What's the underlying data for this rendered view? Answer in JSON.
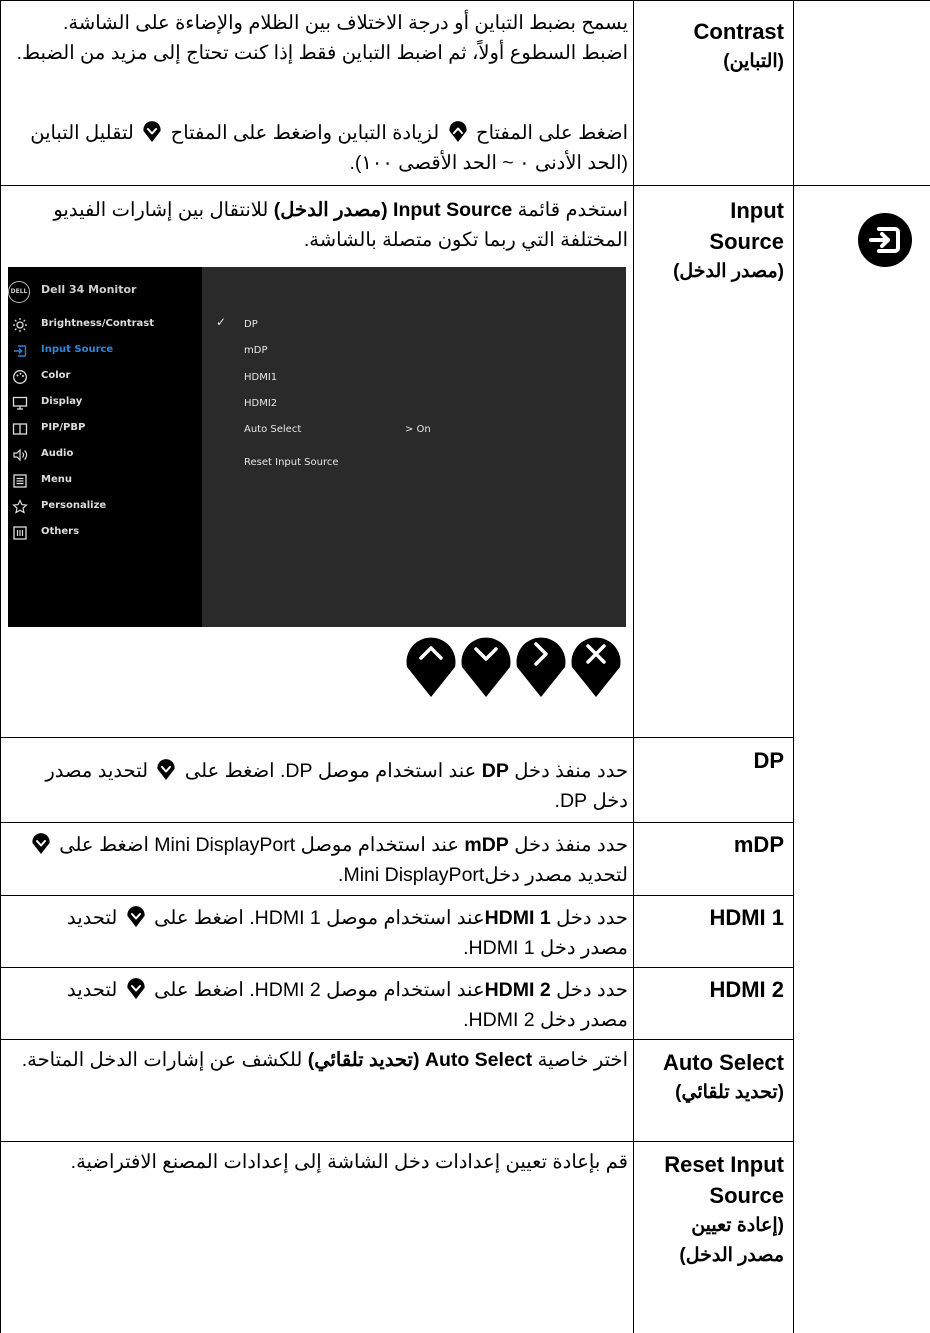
{
  "rows": {
    "contrast": {
      "title": "Contrast",
      "title_ar": "(التباين)",
      "desc1": "يسمح بضبط التباين أو درجة الاختلاف بين الظلام والإضاءة على الشاشة. اضبط السطوع أولاً، ثم اضبط التباين فقط إذا كنت تحتاج إلى مزيد من الضبط.",
      "desc2_a": "اضغط على المفتاح",
      "desc2_b": "لزيادة التباين واضغط على المفتاح",
      "desc2_c": "لتقليل التباين (الحد الأدنى ٠ ~ الحد الأقصى ١٠٠)."
    },
    "input_source": {
      "title": "Input Source",
      "title_ar": "(مصدر الدخل)",
      "icon": "input-source-icon",
      "desc_a": "استخدم قائمة",
      "desc_bold_en": "Input Source",
      "desc_bold_ar": "(مصدر الدخل)",
      "desc_b": "للانتقال بين إشارات الفيديو المختلفة التي ربما تكون متصلة بالشاشة."
    },
    "dp": {
      "title": "DP",
      "a": "حدد منفذ دخل",
      "bold": "DP",
      "b": "عند استخدام موصل DP. اضغط على",
      "c": "لتحديد مصدر دخل DP."
    },
    "mdp": {
      "title": "mDP",
      "a": "حدد منفذ دخل",
      "bold": "mDP",
      "b": "عند استخدام موصل Mini DisplayPort اضغط على",
      "c": "لتحديد مصدر دخلMini DisplayPort."
    },
    "hdmi1": {
      "title": "HDMI 1",
      "a": "حدد دخل",
      "bold": "HDMI 1",
      "b": "عند استخدام موصل HDMI 1. اضغط على",
      "c": "لتحديد مصدر دخل HDMI 1."
    },
    "hdmi2": {
      "title": "HDMI 2",
      "a": "حدد دخل",
      "bold": "HDMI 2",
      "b": "عند استخدام موصل HDMI 2. اضغط على",
      "c": "لتحديد مصدر دخل HDMI 2."
    },
    "auto_select": {
      "title": "Auto Select",
      "title_ar": "(تحديد تلقائي)",
      "a": "اختر خاصية",
      "bold_en": "Auto Select",
      "bold_ar": "(تحديد تلقائي)",
      "b": "للكشف عن إشارات الدخل المتاحة."
    },
    "reset": {
      "title": "Reset Input Source",
      "title_ar": "(إعادة تعيين مصدر الدخل)",
      "desc": "قم بإعادة تعيين إعدادات دخل الشاشة إلى إعدادات المصنع الافتراضية."
    }
  },
  "osd": {
    "logo": "DELL",
    "title": "Dell 34 Monitor",
    "menu": [
      {
        "label": "Brightness/Contrast",
        "icon": "brightness-icon",
        "active": false
      },
      {
        "label": "Input Source",
        "icon": "input-source-icon",
        "active": true
      },
      {
        "label": "Color",
        "icon": "color-icon",
        "active": false
      },
      {
        "label": "Display",
        "icon": "display-icon",
        "active": false
      },
      {
        "label": "PIP/PBP",
        "icon": "pip-pbp-icon",
        "active": false
      },
      {
        "label": "Audio",
        "icon": "audio-icon",
        "active": false
      },
      {
        "label": "Menu",
        "icon": "menu-icon",
        "active": false
      },
      {
        "label": "Personalize",
        "icon": "star-icon",
        "active": false
      },
      {
        "label": "Others",
        "icon": "others-icon",
        "active": false
      }
    ],
    "options": [
      "DP",
      "mDP",
      "HDMI1",
      "HDMI2",
      "Auto Select",
      "Reset Input Source"
    ],
    "selected": "DP",
    "auto_select_value": "> On",
    "accent": "#2e86d6"
  },
  "nav_buttons": [
    "up-button",
    "down-button",
    "right-button",
    "exit-button"
  ]
}
